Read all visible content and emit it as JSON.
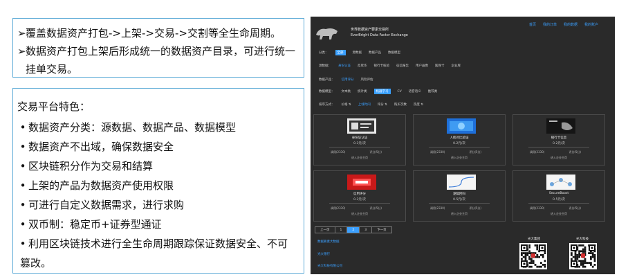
{
  "panel_top": {
    "line1": "覆盖数据资产打包->上架->交易->交割等全生命周期。",
    "line2a": "数据资产打包上架后形成统一的数据资产目录，可进行统一",
    "line2b": "挂单交易。",
    "marker": "➢"
  },
  "panel_features": {
    "heading": "交易平台特色：",
    "bullet": "•",
    "items": [
      "数据资产分类：源数据、数据产品、数据模型",
      "数据资产不出域，确保数据安全",
      "区块链积分作为交易和结算",
      "上架的产品为数据资产使用权限",
      "可进行自定义数据需求，进行求购",
      "双币制：稳定币+证券型通证",
      "利用区块链技术进行全生命周期跟踪保证数据安全、不可"
    ],
    "last_continuation": "篡改。"
  },
  "screenshot": {
    "brand_line1": "世界数据资产要素交易所",
    "brand_line2": "EverBright Data Factor Exchange",
    "topnav": [
      "首页",
      "我的订单",
      "我的数据",
      "我的账户"
    ],
    "filter_rows": [
      {
        "label": "分类：",
        "items": [
          "全部",
          "源数据",
          "数据产品",
          "数据模型"
        ],
        "selected": 0
      },
      {
        "label": "源数据：",
        "items": [
          "身份认证",
          "反欺诈",
          "银行卡核验",
          "征信报告",
          "用户画像",
          "医保卡",
          "企业库"
        ],
        "highlight": 0
      },
      {
        "label": "数据产品：",
        "items": [
          "信用评分",
          "风险评估"
        ],
        "highlight": 0
      },
      {
        "label": "数据模型：",
        "items": [
          "文本类",
          "统计类",
          "机器学习",
          "CV",
          "语音语义",
          "推荐类"
        ],
        "selected": 2
      },
      {
        "label": "排序方式：",
        "items": [
          "价格 ⇅",
          "上线时间",
          "评分 ⇅",
          "购买次数",
          "热度 ⇅"
        ],
        "highlight": 1
      }
    ],
    "cards": [
      {
        "name": "身份证认证",
        "price": "0.3元/次",
        "meta_left": "调用(2330)",
        "meta_right": "评分(5分)",
        "action": "进入企业主页",
        "img": "id-card"
      },
      {
        "name": "人脸对比验证",
        "price": "0.2元/次",
        "meta_left": "调用(2330)",
        "meta_right": "评分(5分)",
        "action": "进入企业主页",
        "img": "face"
      },
      {
        "name": "银行卡信息",
        "price": "0.2元/次",
        "meta_left": "调用(2330)",
        "meta_right": "评分(5分)",
        "action": "进入企业主页",
        "img": "bank"
      },
      {
        "name": "信用评分",
        "price": "0.3元/次",
        "meta_left": "调用(2330)",
        "meta_right": "评分(5分)",
        "action": "进入企业主页",
        "img": "credit"
      },
      {
        "name": "逻辑回归",
        "price": "0.5元/次",
        "meta_left": "调用(2330)",
        "meta_right": "评分(5分)",
        "action": "进入企业主页",
        "img": "logistic"
      },
      {
        "name": "SecureBoost",
        "price": "0.5元/次",
        "meta_left": "调用(2330)",
        "meta_right": "评分(5分)",
        "action": "进入企业主页",
        "img": "secureboost"
      }
    ],
    "pager": [
      "上一页",
      "1",
      "2",
      "3",
      "下一页"
    ],
    "pager_current": 2,
    "footer_links": [
      "数据要素大数据",
      "光大银行",
      "光大科技有限公司"
    ],
    "qr_labels": [
      "光大集团",
      "光大科技"
    ],
    "colors": {
      "accent": "#3ba0ff",
      "bg": "#2a2a2a",
      "box_border": "#5aa9d6"
    }
  }
}
